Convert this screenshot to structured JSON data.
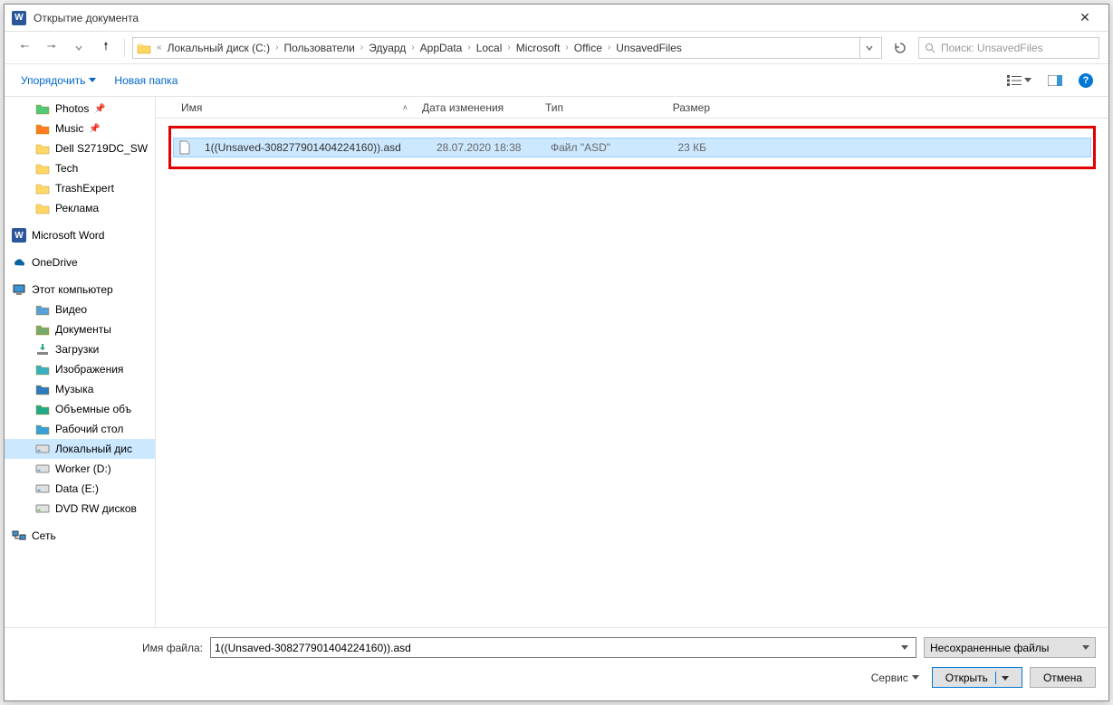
{
  "title": "Открытие документа",
  "breadcrumbs": [
    "Локальный диск (C:)",
    "Пользователи",
    "Эдуард",
    "AppData",
    "Local",
    "Microsoft",
    "Office",
    "UnsavedFiles"
  ],
  "search_placeholder": "Поиск: UnsavedFiles",
  "toolbar": {
    "organize": "Упорядочить",
    "new_folder": "Новая папка"
  },
  "columns": {
    "name": "Имя",
    "date": "Дата изменения",
    "type": "Тип",
    "size": "Размер"
  },
  "file": {
    "name": "1((Unsaved-308277901404224160)).asd",
    "date": "28.07.2020 18:38",
    "type": "Файл \"ASD\"",
    "size": "23 КБ"
  },
  "sidebar": {
    "quick": [
      {
        "label": "Photos",
        "icon": "photos",
        "pinned": true
      },
      {
        "label": "Music",
        "icon": "music",
        "pinned": true
      },
      {
        "label": "Dell S2719DC_SW",
        "icon": "folder",
        "pinned": false
      },
      {
        "label": "Tech",
        "icon": "folder",
        "pinned": false
      },
      {
        "label": "TrashExpert",
        "icon": "folder",
        "pinned": false
      },
      {
        "label": "Реклама",
        "icon": "folder",
        "pinned": false
      }
    ],
    "word": "Microsoft Word",
    "onedrive": "OneDrive",
    "thispc": "Этот компьютер",
    "pc_items": [
      {
        "label": "Видео",
        "icon": "video"
      },
      {
        "label": "Документы",
        "icon": "docs"
      },
      {
        "label": "Загрузки",
        "icon": "downloads"
      },
      {
        "label": "Изображения",
        "icon": "images"
      },
      {
        "label": "Музыка",
        "icon": "music2"
      },
      {
        "label": "Объемные объ",
        "icon": "3d"
      },
      {
        "label": "Рабочий стол",
        "icon": "desktop"
      },
      {
        "label": "Локальный дис",
        "icon": "drive",
        "selected": true
      },
      {
        "label": "Worker (D:)",
        "icon": "drive"
      },
      {
        "label": "Data (E:)",
        "icon": "drive"
      },
      {
        "label": "DVD RW дисков",
        "icon": "dvd"
      }
    ],
    "network": "Сеть"
  },
  "footer": {
    "file_label": "Имя файла:",
    "filename_value": "1((Unsaved-308277901404224160)).asd",
    "filter": "Несохраненные файлы",
    "tools": "Сервис",
    "open": "Открыть",
    "cancel": "Отмена"
  }
}
